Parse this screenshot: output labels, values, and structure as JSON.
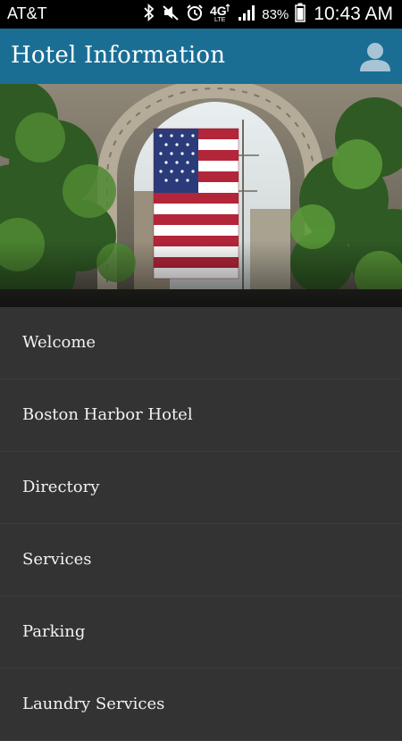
{
  "status_bar": {
    "carrier": "AT&T",
    "network": "4G LTE",
    "battery": "83%",
    "time": "10:43 AM",
    "icons": [
      "bluetooth-icon",
      "mute-icon",
      "alarm-icon",
      "network-4g-icon",
      "signal-icon",
      "battery-icon"
    ]
  },
  "app_bar": {
    "title": "Hotel Information",
    "profile_icon": "person-icon",
    "color": "#1a6e94"
  },
  "hero": {
    "description_icon": "hero-photo-flag-archway"
  },
  "menu": {
    "items": [
      {
        "label": "Welcome"
      },
      {
        "label": "Boston Harbor Hotel"
      },
      {
        "label": "Directory"
      },
      {
        "label": "Services"
      },
      {
        "label": "Parking"
      },
      {
        "label": "Laundry Services"
      }
    ]
  }
}
